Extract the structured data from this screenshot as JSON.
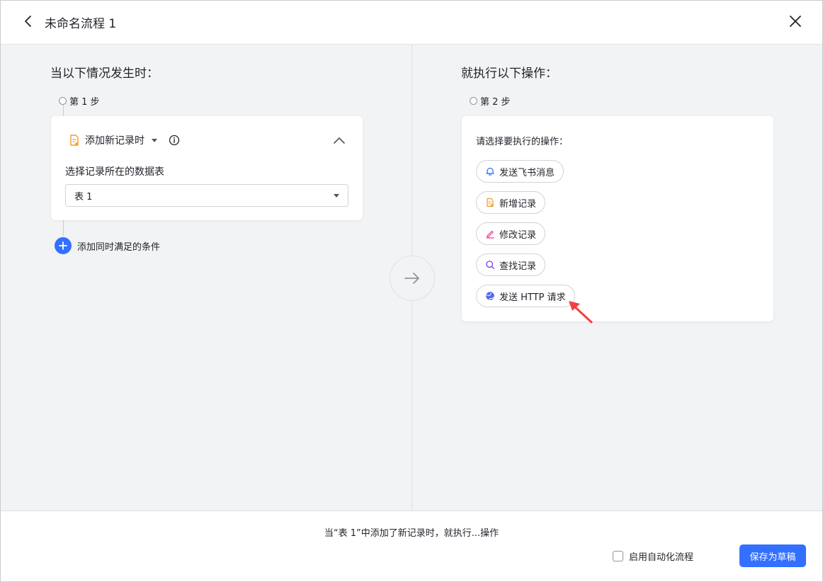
{
  "header": {
    "title": "未命名流程 1"
  },
  "left": {
    "heading": "当以下情况发生时：",
    "step_label": "第 1 步",
    "trigger": {
      "label": "添加新记录时",
      "icon": "doc-add-icon"
    },
    "field_label": "选择记录所在的数据表",
    "table_select": {
      "value": "表 1"
    },
    "add_condition_label": "添加同时满足的条件"
  },
  "right": {
    "heading": "就执行以下操作：",
    "step_label": "第 2 步",
    "prompt": "请选择要执行的操作：",
    "actions": [
      {
        "label": "发送飞书消息",
        "icon": "bell-icon",
        "color": "#3370ff"
      },
      {
        "label": "新增记录",
        "icon": "doc-add-icon",
        "color": "#f59a23"
      },
      {
        "label": "修改记录",
        "icon": "pen-icon",
        "color": "#e23b8f"
      },
      {
        "label": "查找记录",
        "icon": "search-icon",
        "color": "#7f3bf5"
      },
      {
        "label": "发送 HTTP 请求",
        "icon": "globe-icon",
        "color": "#4e6ae8"
      }
    ]
  },
  "footer": {
    "summary": "当“表 1”中添加了新记录时，就执行...操作",
    "auto_enable_label": "启用自动化流程",
    "save_label": "保存为草稿"
  },
  "colors": {
    "accent": "#3370ff",
    "annotation": "#f53f3f"
  }
}
